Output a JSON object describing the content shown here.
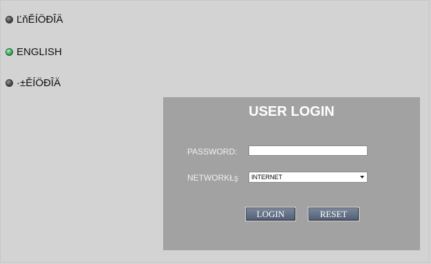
{
  "languages": [
    {
      "label": "ĽňĔÍÖĐÎÄ",
      "indicator": "gray"
    },
    {
      "label": "ENGLISH",
      "indicator": "green"
    },
    {
      "label": "·±ĚÍÖĐÎÄ",
      "indicator": "gray"
    }
  ],
  "login": {
    "title": "USER LOGIN",
    "password_label": "PASSWORD:",
    "password_value": "",
    "network_label": "NETWORKŁş",
    "network_selected": "INTERNET",
    "login_button": "LOGIN",
    "reset_button": "RESET"
  },
  "colors": {
    "background": "#d3d3d3",
    "panel": "#a2a2a2",
    "button": "#5f6c82",
    "active_indicator": "#3fbf6a"
  }
}
